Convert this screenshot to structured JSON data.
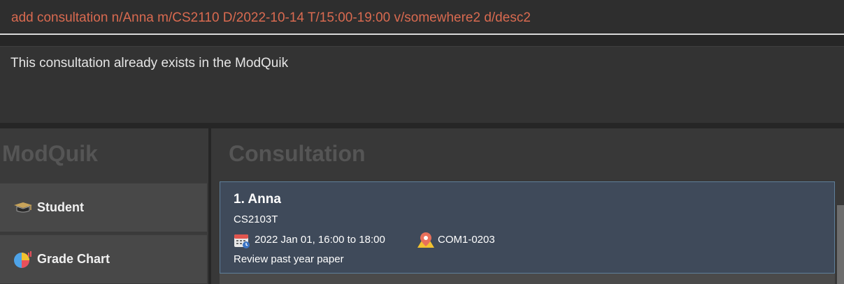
{
  "command_box": {
    "text": "add consultation n/Anna m/CS2110 D/2022-10-14 T/15:00-19:00 v/somewhere2 d/desc2"
  },
  "result_display": {
    "message": "This consultation already exists in the ModQuik"
  },
  "sidebar": {
    "title": "ModQuik",
    "items": [
      {
        "label": "Student",
        "icon": "graduation-cap-icon"
      },
      {
        "label": "Grade Chart",
        "icon": "pie-chart-icon"
      }
    ]
  },
  "main": {
    "title": "Consultation",
    "cards": [
      {
        "index_name": "1.  Anna",
        "module": "CS2103T",
        "datetime": "2022 Jan 01, 16:00 to 18:00",
        "venue": "COM1-0203",
        "description": "Review past year paper"
      }
    ]
  },
  "colors": {
    "command_text": "#d96a50",
    "card_background": "#3f4a5a",
    "card_border": "#5f7f9a"
  }
}
